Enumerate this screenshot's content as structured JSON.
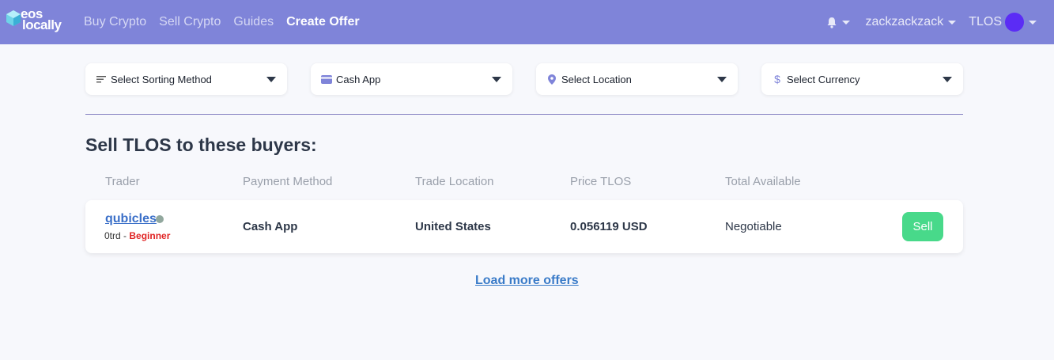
{
  "nav": {
    "logo_line1": "eos",
    "logo_line2": "locally",
    "links": [
      "Buy Crypto",
      "Sell Crypto",
      "Guides",
      "Create Offer"
    ],
    "username": "zackzackzack",
    "token": "TLOS"
  },
  "filters": {
    "sort": "Select Sorting Method",
    "payment": "Cash App",
    "location": "Select Location",
    "currency": "Select Currency"
  },
  "section_title": "Sell TLOS to these buyers:",
  "columns": [
    "Trader",
    "Payment Method",
    "Trade Location",
    "Price TLOS",
    "Total Available"
  ],
  "offers": [
    {
      "trader": "qubicles",
      "trades": "0trd",
      "separator": " - ",
      "rank": "Beginner",
      "payment_method": "Cash App",
      "location": "United States",
      "price": "0.056119 USD",
      "available": "Negotiable",
      "action": "Sell"
    }
  ],
  "load_more": "Load more offers",
  "colors": {
    "navbar": "#7f84d9",
    "accent_green": "#48d98a",
    "link_blue": "#3a6fc8",
    "rank_red": "#e02424",
    "avatar": "#5b2cf5"
  }
}
